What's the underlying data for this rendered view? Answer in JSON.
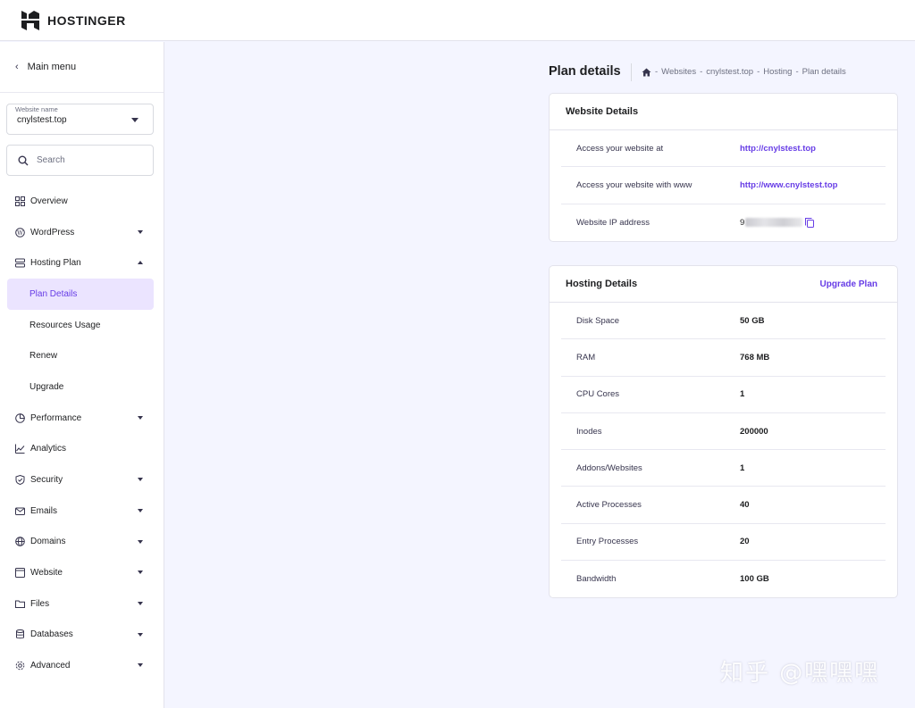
{
  "brand": {
    "name": "HOSTINGER",
    "icon": "hostinger-logo-icon"
  },
  "sidebar": {
    "main_menu": "Main menu",
    "website_name_label": "Website name",
    "website_name_value": "cnylstest.top",
    "search_placeholder": "Search",
    "items": [
      {
        "label": "Overview",
        "icon": "grid-icon"
      },
      {
        "label": "WordPress",
        "icon": "wordpress-icon"
      },
      {
        "label": "Hosting Plan",
        "icon": "server-icon"
      },
      {
        "label": "Plan Details"
      },
      {
        "label": "Resources Usage"
      },
      {
        "label": "Renew"
      },
      {
        "label": "Upgrade"
      },
      {
        "label": "Performance",
        "icon": "gauge-icon"
      },
      {
        "label": "Analytics",
        "icon": "chart-line-icon"
      },
      {
        "label": "Security",
        "icon": "shield-icon"
      },
      {
        "label": "Emails",
        "icon": "mail-icon"
      },
      {
        "label": "Domains",
        "icon": "globe-icon"
      },
      {
        "label": "Website",
        "icon": "window-icon"
      },
      {
        "label": "Files",
        "icon": "folder-icon"
      },
      {
        "label": "Databases",
        "icon": "database-icon"
      },
      {
        "label": "Advanced",
        "icon": "gear-icon"
      }
    ]
  },
  "page": {
    "title": "Plan details",
    "breadcrumb": [
      "Websites",
      "cnylstest.top",
      "Hosting",
      "Plan details"
    ],
    "breadcrumb_sep": "-"
  },
  "website_details": {
    "title": "Website Details",
    "rows": [
      {
        "label": "Access your website at",
        "value": "http://cnylstest.top"
      },
      {
        "label": "Access your website with www",
        "value": "http://www.cnylstest.top"
      },
      {
        "label": "Website IP address",
        "value": "9"
      }
    ]
  },
  "hosting_details": {
    "title": "Hosting Details",
    "action": "Upgrade Plan",
    "rows": [
      {
        "label": "Disk Space",
        "value": "50 GB"
      },
      {
        "label": "RAM",
        "value": "768 MB"
      },
      {
        "label": "CPU Cores",
        "value": "1"
      },
      {
        "label": "Inodes",
        "value": "200000"
      },
      {
        "label": "Addons/Websites",
        "value": "1"
      },
      {
        "label": "Active Processes",
        "value": "40"
      },
      {
        "label": "Entry Processes",
        "value": "20"
      },
      {
        "label": "Bandwidth",
        "value": "100 GB"
      }
    ]
  },
  "watermark": "知乎 @嘿嘿嘿",
  "colors": {
    "accent": "#673de6",
    "active_bg": "#ebe4ff",
    "page_bg": "#f4f5ff"
  }
}
